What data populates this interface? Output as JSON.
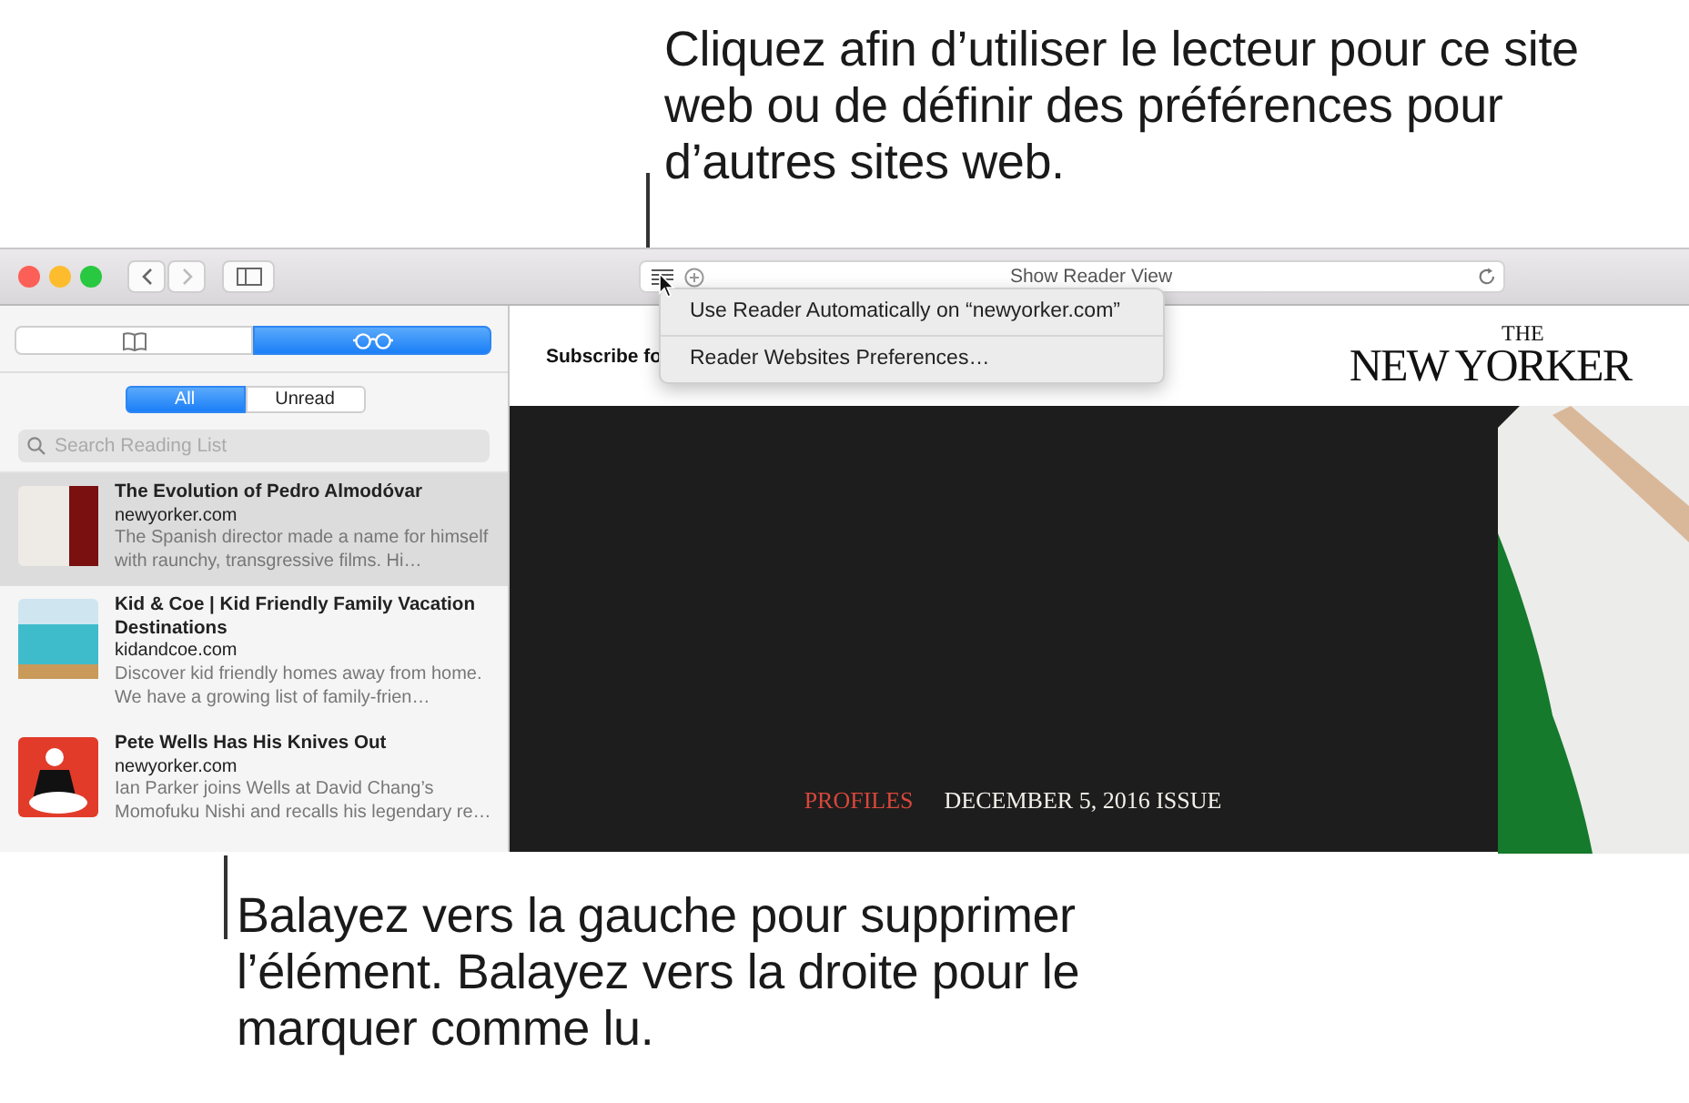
{
  "callouts": [
    {
      "text": "Cliquez afin d’utiliser le lecteur pour ce site web ou de définir des préférences pour d’autres sites web."
    },
    {
      "text": "Balayez vers la gauche pour supprimer l’élément. Balayez vers la droite pour le marquer comme lu."
    }
  ],
  "toolbar": {
    "address_text": "Show Reader View"
  },
  "reader_menu": {
    "items": [
      "Use Reader Automatically on “newyorker.com”",
      "Reader Websites Preferences…"
    ]
  },
  "sidebar": {
    "tabs": [
      {
        "kind": "bookmarks",
        "selected": false
      },
      {
        "kind": "reading-list",
        "selected": true
      }
    ],
    "filters": [
      {
        "label": "All",
        "selected": true
      },
      {
        "label": "Unread",
        "selected": false
      }
    ],
    "search": {
      "placeholder": "Search Reading List"
    },
    "items": [
      {
        "kind": "curtain",
        "title": "The Evolution of Pedro Almodóvar",
        "site": "newyorker.com",
        "summary": "The Spanish director made a name for himself with raunchy, transgressive films. Hi…",
        "selected": true
      },
      {
        "kind": "beach",
        "title": "Kid & Coe | Kid Friendly Family Vacation Destinations",
        "site": "kidandcoe.com",
        "summary": "Discover kid friendly homes away from home. We have a growing list of family-frien…",
        "selected": false
      },
      {
        "kind": "illustration",
        "title": "Pete Wells Has His Knives Out",
        "site": "newyorker.com",
        "summary": "Ian Parker joins Wells at David Chang’s Momofuku Nishi and recalls his legendary re…",
        "selected": false
      }
    ]
  },
  "page": {
    "subscribe_text": "Subscribe fo",
    "logo_top": "THE",
    "logo_main": "NEW YORKER",
    "section": "PROFILES",
    "issue": "DECEMBER 5, 2016 ISSUE"
  }
}
